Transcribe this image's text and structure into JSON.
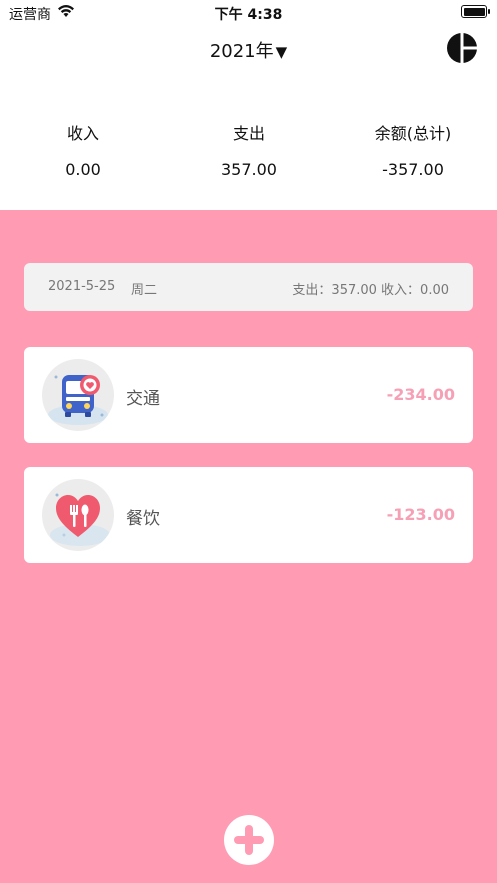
{
  "status_bar": {
    "carrier": "运营商",
    "time": "下午 4:38"
  },
  "nav": {
    "year": "2021年",
    "caret": "▼",
    "chart_icon": "pie-chart-icon"
  },
  "summary": {
    "income_label": "收入",
    "income_value": "0.00",
    "expense_label": "支出",
    "expense_value": "357.00",
    "balance_label": "余额(总计)",
    "balance_value": "-357.00"
  },
  "day": {
    "date": "2021-5-25",
    "weekday": "周二",
    "totals": "支出：357.00 收入：0.00"
  },
  "records": [
    {
      "category": "交通",
      "amount": "-234.00",
      "icon": "bus-icon"
    },
    {
      "category": "餐饮",
      "amount": "-123.00",
      "icon": "dining-heart-icon"
    }
  ],
  "colors": {
    "accent_pink": "#ff9bb3",
    "amount_pink": "#f6a0b6",
    "header_gray": "#f2f2f2"
  },
  "add_button_icon": "plus-icon"
}
